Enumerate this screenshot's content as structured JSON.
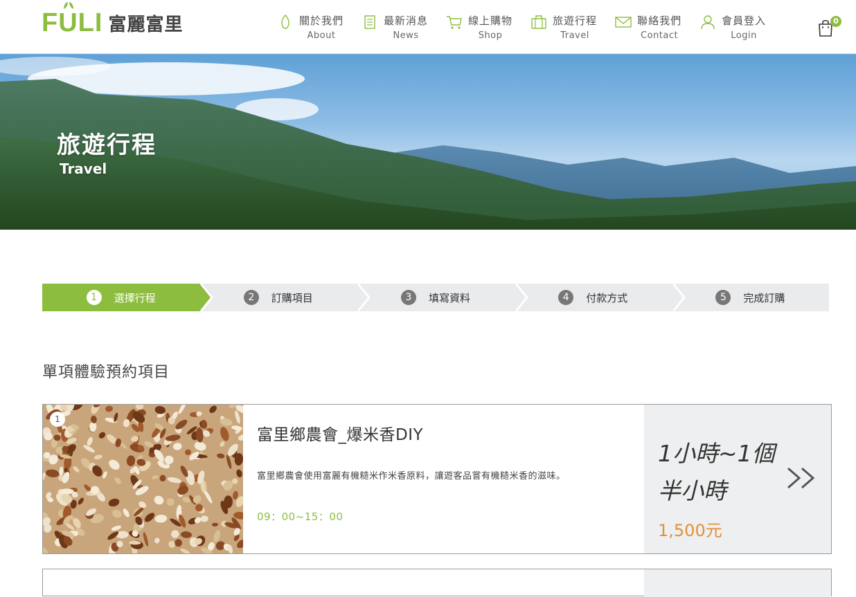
{
  "brand": {
    "logo_word": "FULI",
    "logo_cn": "富麗富里",
    "accent": "#8cbd3f"
  },
  "nav": [
    {
      "cn": "關於我們",
      "en": "About",
      "icon": "leaf-icon"
    },
    {
      "cn": "最新消息",
      "en": "News",
      "icon": "document-icon"
    },
    {
      "cn": "線上購物",
      "en": "Shop",
      "icon": "cart-icon"
    },
    {
      "cn": "旅遊行程",
      "en": "Travel",
      "icon": "luggage-icon"
    },
    {
      "cn": "聯絡我們",
      "en": "Contact",
      "icon": "mail-icon"
    },
    {
      "cn": "會員登入",
      "en": "Login",
      "icon": "user-icon"
    }
  ],
  "cart": {
    "count": "0",
    "icon": "shopping-bag-icon"
  },
  "banner": {
    "title": "旅遊行程",
    "subtitle": "Travel"
  },
  "steps": [
    {
      "num": "1",
      "label": "選擇行程",
      "active": true
    },
    {
      "num": "2",
      "label": "訂購項目",
      "active": false
    },
    {
      "num": "3",
      "label": "填寫資料",
      "active": false
    },
    {
      "num": "4",
      "label": "付款方式",
      "active": false
    },
    {
      "num": "5",
      "label": "完成訂購",
      "active": false
    }
  ],
  "section": {
    "title": "單項體驗預約項目"
  },
  "items": [
    {
      "num": "1",
      "title": "富里鄉農會_爆米香DIY",
      "desc": "富里鄉農會使用富麗有機糙米作米香原料，讓遊客品嘗有機糙米香的滋味。",
      "time": "09：00~15：00",
      "duration": "1小時~1個半小時",
      "price": "1,500元",
      "go_icon": "double-chevron-right-icon"
    }
  ]
}
